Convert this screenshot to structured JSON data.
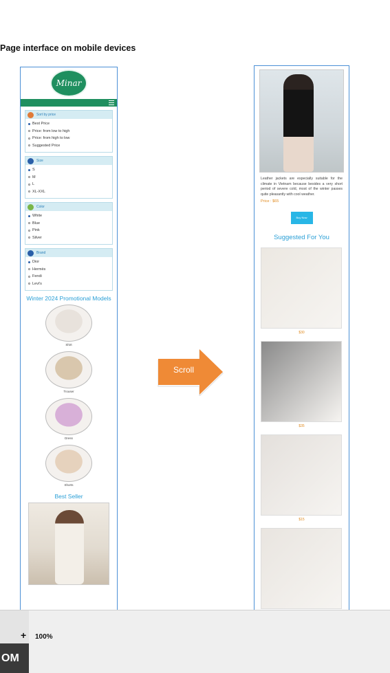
{
  "caption": "Page interface on mobile devices",
  "left_phone": {
    "logo_text": "Minar",
    "filters": [
      {
        "title": "Sort by price",
        "icon": "sort-icon",
        "color": "#e07b39",
        "options": [
          {
            "label": "Best Price",
            "selected": true
          },
          {
            "label": "Price: from low to high",
            "selected": false
          },
          {
            "label": "Price: from high to low",
            "selected": false
          },
          {
            "label": "Suggested Price",
            "selected": false
          }
        ]
      },
      {
        "title": "Size",
        "icon": "size-icon",
        "color": "#2a5fa8",
        "options": [
          {
            "label": "S",
            "selected": true
          },
          {
            "label": "M",
            "selected": false
          },
          {
            "label": "L",
            "selected": false
          },
          {
            "label": "XL-XXL",
            "selected": false
          }
        ]
      },
      {
        "title": "Color",
        "icon": "color-icon",
        "color": "#7ab648",
        "options": [
          {
            "label": "White",
            "selected": true
          },
          {
            "label": "Blue",
            "selected": false
          },
          {
            "label": "Pink",
            "selected": false
          },
          {
            "label": "Silver",
            "selected": false
          }
        ]
      },
      {
        "title": "Brand",
        "icon": "brand-icon",
        "color": "#2a5fa8",
        "options": [
          {
            "label": "Dior",
            "selected": true
          },
          {
            "label": "Hermès",
            "selected": false
          },
          {
            "label": "Fendi",
            "selected": false
          },
          {
            "label": "Levi's",
            "selected": false
          }
        ]
      }
    ],
    "promo_title": "Winter 2024 Promotional Models",
    "promo_items": [
      {
        "label": "Shirt",
        "tone": "#e8e2dc"
      },
      {
        "label": "Trouser",
        "tone": "#d9c7ad"
      },
      {
        "label": "Dress",
        "tone": "#d8b0d8"
      },
      {
        "label": "Shorts",
        "tone": "#e6d2bd"
      }
    ],
    "best_seller_title": "Best Seller"
  },
  "right_phone": {
    "description": "Leather jackets are especially suitable for the climate in Vietnam because besides a very short period of severe cold, most of the winter passes quite pleasantly with cool weather.",
    "price": "Price : $65",
    "buy_label": "Buy Now",
    "suggest_title": "Suggested For You",
    "products": [
      {
        "price": "$30",
        "tone": "#ece8e2"
      },
      {
        "price": "$35",
        "tone": "#8a8a8a"
      },
      {
        "price": "$15",
        "tone": "#e4e0dc"
      },
      {
        "price": "",
        "tone": "#e9e5e0"
      }
    ]
  },
  "scroll_label": "Scroll",
  "toolbar": {
    "plus": "+",
    "zoom": "100%",
    "brand_fragment": "OM"
  }
}
